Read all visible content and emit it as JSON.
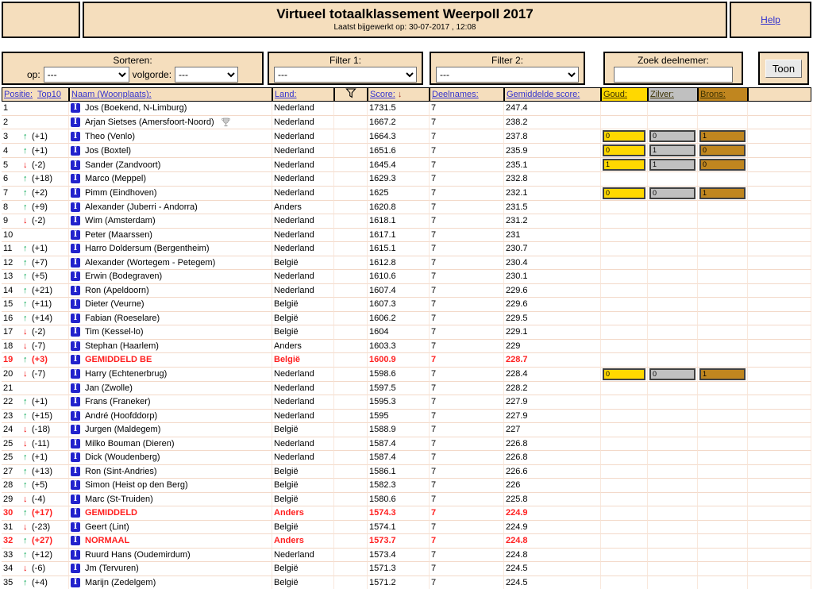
{
  "header": {
    "title": "Virtueel totaalklassement Weerpoll 2017",
    "subtitle": "Laatst bijgewerkt op: 30-07-2017 , 12:08",
    "help_label": "Help"
  },
  "controls": {
    "sorteren_label": "Sorteren:",
    "op_label": "op:",
    "op_value": "---",
    "volgorde_label": "volgorde:",
    "volgorde_value": "---",
    "filter1_label": "Filter 1:",
    "filter1_value": "---",
    "filter2_label": "Filter 2:",
    "filter2_value": "---",
    "zoek_label": "Zoek deelnemer:",
    "zoek_value": "",
    "toon_label": "Toon"
  },
  "icons": {
    "info_glyph": "I",
    "sort_arrow": "↓",
    "up_arrow": "↑",
    "down_arrow": "↓"
  },
  "colors": {
    "panel_bg": "#F5DEBD",
    "gold": "#FFD800",
    "silver": "#C0C0C0",
    "bronze": "#C0861F",
    "link": "#3332CE",
    "up_green": "#00A651",
    "down_red": "#EE0000",
    "special_red": "#FF1F1F"
  },
  "table": {
    "headers": {
      "positie": "Positie:",
      "top10": "Top10",
      "naam": "Naam (Woonplaats):",
      "land": "Land:",
      "score": "Score:",
      "deelnames": "Deelnames:",
      "gemiddelde": "Gemiddelde score:",
      "goud": "Goud:",
      "zilver": "Zilver:",
      "brons": "Brons:"
    },
    "rows": [
      {
        "pos": "1",
        "dir": "",
        "move": "",
        "name": "Jos (Boekend, N-Limburg)",
        "trophy": false,
        "land": "Nederland",
        "score": "1731.5",
        "deelnames": "7",
        "gem": "247.4",
        "goud": "",
        "zilver": "",
        "brons": "",
        "special": false
      },
      {
        "pos": "2",
        "dir": "",
        "move": "",
        "name": "Arjan Sietses (Amersfoort-Noord)",
        "trophy": true,
        "land": "Nederland",
        "score": "1667.2",
        "deelnames": "7",
        "gem": "238.2",
        "goud": "",
        "zilver": "",
        "brons": "",
        "special": false
      },
      {
        "pos": "3",
        "dir": "up",
        "move": "(+1)",
        "name": "Theo (Venlo)",
        "trophy": false,
        "land": "Nederland",
        "score": "1664.3",
        "deelnames": "7",
        "gem": "237.8",
        "goud": "0",
        "zilver": "0",
        "brons": "1",
        "special": false
      },
      {
        "pos": "4",
        "dir": "up",
        "move": "(+1)",
        "name": "Jos (Boxtel)",
        "trophy": false,
        "land": "Nederland",
        "score": "1651.6",
        "deelnames": "7",
        "gem": "235.9",
        "goud": "0",
        "zilver": "1",
        "brons": "0",
        "special": false
      },
      {
        "pos": "5",
        "dir": "down",
        "move": "(-2)",
        "name": "Sander (Zandvoort)",
        "trophy": false,
        "land": "Nederland",
        "score": "1645.4",
        "deelnames": "7",
        "gem": "235.1",
        "goud": "1",
        "zilver": "1",
        "brons": "0",
        "special": false
      },
      {
        "pos": "6",
        "dir": "up",
        "move": "(+18)",
        "name": "Marco (Meppel)",
        "trophy": false,
        "land": "Nederland",
        "score": "1629.3",
        "deelnames": "7",
        "gem": "232.8",
        "goud": "",
        "zilver": "",
        "brons": "",
        "special": false
      },
      {
        "pos": "7",
        "dir": "up",
        "move": "(+2)",
        "name": "Pimm (Eindhoven)",
        "trophy": false,
        "land": "Nederland",
        "score": "1625",
        "deelnames": "7",
        "gem": "232.1",
        "goud": "0",
        "zilver": "0",
        "brons": "1",
        "special": false
      },
      {
        "pos": "8",
        "dir": "up",
        "move": "(+9)",
        "name": "Alexander (Juberri - Andorra)",
        "trophy": false,
        "land": "Anders",
        "score": "1620.8",
        "deelnames": "7",
        "gem": "231.5",
        "goud": "",
        "zilver": "",
        "brons": "",
        "special": false
      },
      {
        "pos": "9",
        "dir": "down",
        "move": "(-2)",
        "name": "Wim (Amsterdam)",
        "trophy": false,
        "land": "Nederland",
        "score": "1618.1",
        "deelnames": "7",
        "gem": "231.2",
        "goud": "",
        "zilver": "",
        "brons": "",
        "special": false
      },
      {
        "pos": "10",
        "dir": "",
        "move": "",
        "name": "Peter (Maarssen)",
        "trophy": false,
        "land": "Nederland",
        "score": "1617.1",
        "deelnames": "7",
        "gem": "231",
        "goud": "",
        "zilver": "",
        "brons": "",
        "special": false
      },
      {
        "pos": "11",
        "dir": "up",
        "move": "(+1)",
        "name": "Harro Doldersum (Bergentheim)",
        "trophy": false,
        "land": "Nederland",
        "score": "1615.1",
        "deelnames": "7",
        "gem": "230.7",
        "goud": "",
        "zilver": "",
        "brons": "",
        "special": false
      },
      {
        "pos": "12",
        "dir": "up",
        "move": "(+7)",
        "name": "Alexander (Wortegem - Petegem)",
        "trophy": false,
        "land": "België",
        "score": "1612.8",
        "deelnames": "7",
        "gem": "230.4",
        "goud": "",
        "zilver": "",
        "brons": "",
        "special": false
      },
      {
        "pos": "13",
        "dir": "up",
        "move": "(+5)",
        "name": "Erwin (Bodegraven)",
        "trophy": false,
        "land": "Nederland",
        "score": "1610.6",
        "deelnames": "7",
        "gem": "230.1",
        "goud": "",
        "zilver": "",
        "brons": "",
        "special": false
      },
      {
        "pos": "14",
        "dir": "up",
        "move": "(+21)",
        "name": "Ron (Apeldoorn)",
        "trophy": false,
        "land": "Nederland",
        "score": "1607.4",
        "deelnames": "7",
        "gem": "229.6",
        "goud": "",
        "zilver": "",
        "brons": "",
        "special": false
      },
      {
        "pos": "15",
        "dir": "up",
        "move": "(+11)",
        "name": "Dieter (Veurne)",
        "trophy": false,
        "land": "België",
        "score": "1607.3",
        "deelnames": "7",
        "gem": "229.6",
        "goud": "",
        "zilver": "",
        "brons": "",
        "special": false
      },
      {
        "pos": "16",
        "dir": "up",
        "move": "(+14)",
        "name": "Fabian (Roeselare)",
        "trophy": false,
        "land": "België",
        "score": "1606.2",
        "deelnames": "7",
        "gem": "229.5",
        "goud": "",
        "zilver": "",
        "brons": "",
        "special": false
      },
      {
        "pos": "17",
        "dir": "down",
        "move": "(-2)",
        "name": "Tim (Kessel-lo)",
        "trophy": false,
        "land": "België",
        "score": "1604",
        "deelnames": "7",
        "gem": "229.1",
        "goud": "",
        "zilver": "",
        "brons": "",
        "special": false
      },
      {
        "pos": "18",
        "dir": "down",
        "move": "(-7)",
        "name": "Stephan (Haarlem)",
        "trophy": false,
        "land": "Anders",
        "score": "1603.3",
        "deelnames": "7",
        "gem": "229",
        "goud": "",
        "zilver": "",
        "brons": "",
        "special": false
      },
      {
        "pos": "19",
        "dir": "up",
        "move": "(+3)",
        "name": "GEMIDDELD BE",
        "trophy": false,
        "land": "België",
        "score": "1600.9",
        "deelnames": "7",
        "gem": "228.7",
        "goud": "",
        "zilver": "",
        "brons": "",
        "special": true
      },
      {
        "pos": "20",
        "dir": "down",
        "move": "(-7)",
        "name": "Harry (Echtenerbrug)",
        "trophy": false,
        "land": "Nederland",
        "score": "1598.6",
        "deelnames": "7",
        "gem": "228.4",
        "goud": "0",
        "zilver": "0",
        "brons": "1",
        "special": false
      },
      {
        "pos": "21",
        "dir": "",
        "move": "",
        "name": "Jan (Zwolle)",
        "trophy": false,
        "land": "Nederland",
        "score": "1597.5",
        "deelnames": "7",
        "gem": "228.2",
        "goud": "",
        "zilver": "",
        "brons": "",
        "special": false
      },
      {
        "pos": "22",
        "dir": "up",
        "move": "(+1)",
        "name": "Frans (Franeker)",
        "trophy": false,
        "land": "Nederland",
        "score": "1595.3",
        "deelnames": "7",
        "gem": "227.9",
        "goud": "",
        "zilver": "",
        "brons": "",
        "special": false
      },
      {
        "pos": "23",
        "dir": "up",
        "move": "(+15)",
        "name": "André (Hoofddorp)",
        "trophy": false,
        "land": "Nederland",
        "score": "1595",
        "deelnames": "7",
        "gem": "227.9",
        "goud": "",
        "zilver": "",
        "brons": "",
        "special": false
      },
      {
        "pos": "24",
        "dir": "down",
        "move": "(-18)",
        "name": "Jurgen (Maldegem)",
        "trophy": false,
        "land": "België",
        "score": "1588.9",
        "deelnames": "7",
        "gem": "227",
        "goud": "",
        "zilver": "",
        "brons": "",
        "special": false
      },
      {
        "pos": "25",
        "dir": "down",
        "move": "(-11)",
        "name": "Milko Bouman (Dieren)",
        "trophy": false,
        "land": "Nederland",
        "score": "1587.4",
        "deelnames": "7",
        "gem": "226.8",
        "goud": "",
        "zilver": "",
        "brons": "",
        "special": false
      },
      {
        "pos": "25",
        "dir": "up",
        "move": "(+1)",
        "name": "Dick (Woudenberg)",
        "trophy": false,
        "land": "Nederland",
        "score": "1587.4",
        "deelnames": "7",
        "gem": "226.8",
        "goud": "",
        "zilver": "",
        "brons": "",
        "special": false
      },
      {
        "pos": "27",
        "dir": "up",
        "move": "(+13)",
        "name": "Ron (Sint-Andries)",
        "trophy": false,
        "land": "België",
        "score": "1586.1",
        "deelnames": "7",
        "gem": "226.6",
        "goud": "",
        "zilver": "",
        "brons": "",
        "special": false
      },
      {
        "pos": "28",
        "dir": "up",
        "move": "(+5)",
        "name": "Simon (Heist op den Berg)",
        "trophy": false,
        "land": "België",
        "score": "1582.3",
        "deelnames": "7",
        "gem": "226",
        "goud": "",
        "zilver": "",
        "brons": "",
        "special": false
      },
      {
        "pos": "29",
        "dir": "down",
        "move": "(-4)",
        "name": "Marc (St-Truiden)",
        "trophy": false,
        "land": "België",
        "score": "1580.6",
        "deelnames": "7",
        "gem": "225.8",
        "goud": "",
        "zilver": "",
        "brons": "",
        "special": false
      },
      {
        "pos": "30",
        "dir": "up",
        "move": "(+17)",
        "name": "GEMIDDELD",
        "trophy": false,
        "land": "Anders",
        "score": "1574.3",
        "deelnames": "7",
        "gem": "224.9",
        "goud": "",
        "zilver": "",
        "brons": "",
        "special": true
      },
      {
        "pos": "31",
        "dir": "down",
        "move": "(-23)",
        "name": "Geert (Lint)",
        "trophy": false,
        "land": "België",
        "score": "1574.1",
        "deelnames": "7",
        "gem": "224.9",
        "goud": "",
        "zilver": "",
        "brons": "",
        "special": false
      },
      {
        "pos": "32",
        "dir": "up",
        "move": "(+27)",
        "name": "NORMAAL",
        "trophy": false,
        "land": "Anders",
        "score": "1573.7",
        "deelnames": "7",
        "gem": "224.8",
        "goud": "",
        "zilver": "",
        "brons": "",
        "special": true
      },
      {
        "pos": "33",
        "dir": "up",
        "move": "(+12)",
        "name": "Ruurd Hans (Oudemirdum)",
        "trophy": false,
        "land": "Nederland",
        "score": "1573.4",
        "deelnames": "7",
        "gem": "224.8",
        "goud": "",
        "zilver": "",
        "brons": "",
        "special": false
      },
      {
        "pos": "34",
        "dir": "down",
        "move": "(-6)",
        "name": "Jm (Tervuren)",
        "trophy": false,
        "land": "België",
        "score": "1571.3",
        "deelnames": "7",
        "gem": "224.5",
        "goud": "",
        "zilver": "",
        "brons": "",
        "special": false
      },
      {
        "pos": "35",
        "dir": "up",
        "move": "(+4)",
        "name": "Marijn (Zedelgem)",
        "trophy": false,
        "land": "België",
        "score": "1571.2",
        "deelnames": "7",
        "gem": "224.5",
        "goud": "",
        "zilver": "",
        "brons": "",
        "special": false
      }
    ]
  }
}
